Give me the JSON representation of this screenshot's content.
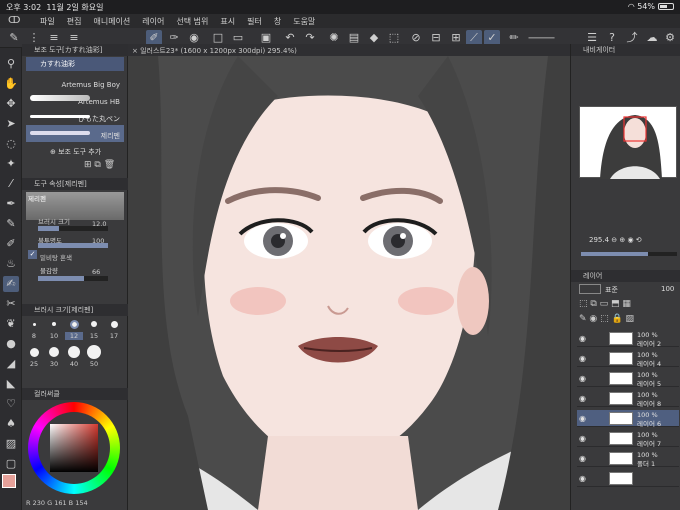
{
  "status": {
    "time": "오후 3:02",
    "date": "11월 2일 화요일",
    "battery": "54%"
  },
  "menu": {
    "items": [
      "파일",
      "편집",
      "애니메이션",
      "레이어",
      "선택 범위",
      "표시",
      "필터",
      "창",
      "도움말"
    ]
  },
  "subtool": {
    "header": "보조 도구[カすれ油彩]",
    "current": "カすれ油彩",
    "brushes": [
      "Artemus Big Boy",
      "Artemus HB",
      "ぴもた丸ペン",
      "제리펜"
    ],
    "add_label": "보조 도구 추가"
  },
  "toolprops": {
    "header": "도구 속성[제리펜]",
    "brush_name": "제리펜",
    "size_label": "브러시 크기",
    "size_value": "12.0",
    "size_fraction": 0.3,
    "opacity_label": "불투명도",
    "opacity_value": "100",
    "opacity_fraction": 1.0,
    "stabilize_label": "밑비탕 혼색",
    "amount_label": "물감량",
    "amount_value": "66",
    "amount_fraction": 0.66
  },
  "brushsize": {
    "header": "브러시 크기[제리펜]",
    "sizes": [
      "8",
      "10",
      "12",
      "15",
      "17",
      "25",
      "30",
      "40",
      "50"
    ],
    "selected": "12"
  },
  "color": {
    "header": "컬러써클",
    "r": "230",
    "g": "161",
    "b": "154",
    "main": "#e6a19a",
    "sub": "#ffffff"
  },
  "canvas": {
    "tab": "일러스트23* (1600 x 1200px 300dpi) 295.4%)"
  },
  "navigator": {
    "header": "내비게이터",
    "zoom": "295.4"
  },
  "layers": {
    "header": "레이어",
    "blend": "표준",
    "opacity": "100",
    "list": [
      {
        "percent": "100 %",
        "name": "레이어 2"
      },
      {
        "percent": "100 %",
        "name": "레이어 4"
      },
      {
        "percent": "100 %",
        "name": "레이어 5"
      },
      {
        "percent": "100 %",
        "name": "레이어 8"
      },
      {
        "percent": "100 %",
        "name": "레이어 6"
      },
      {
        "percent": "100 %",
        "name": "레이어 7"
      },
      {
        "percent": "100 %",
        "name": "폴더 1"
      },
      {
        "percent": "",
        "name": ""
      }
    ]
  }
}
